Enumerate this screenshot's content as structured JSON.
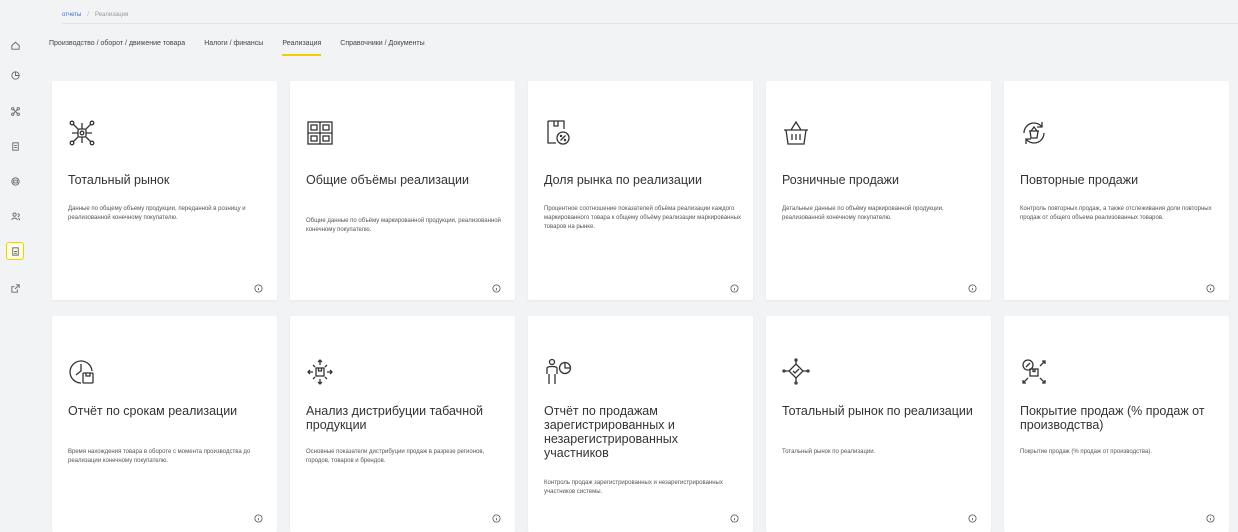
{
  "breadcrumb": {
    "root": "отчеты",
    "separator": "/",
    "current": "Реализация"
  },
  "tabs": [
    {
      "label": "Производство / оборот / движение товара",
      "active": false
    },
    {
      "label": "Налоги / финансы",
      "active": false
    },
    {
      "label": "Реализация",
      "active": true
    },
    {
      "label": "Справочники / Документы",
      "active": false
    }
  ],
  "sidebar": {
    "items": [
      {
        "icon": "home-icon"
      },
      {
        "icon": "pie-chart-icon"
      },
      {
        "icon": "network-icon"
      },
      {
        "icon": "document-icon"
      },
      {
        "icon": "box-icon"
      },
      {
        "icon": "users-icon"
      },
      {
        "icon": "report-icon",
        "active": true
      },
      {
        "icon": "external-link-icon"
      }
    ]
  },
  "cards": [
    {
      "icon": "network-hub-icon",
      "title": "Тотальный рынок",
      "description": "Данные по общему объему продукции, переданной в розницу и реализованной конечному покупателю."
    },
    {
      "icon": "boxes-icon",
      "title": "Общие объёмы реализации",
      "description": "Общие данные по объёму маркированной продукции, реализованной конечному покупателю."
    },
    {
      "icon": "box-percent-icon",
      "title": "Доля рынка по реализации",
      "description": "Процентное соотношение показателей объёма реализации каждого маркированного товара к общему объёму реализации маркированных товаров на рынке."
    },
    {
      "icon": "basket-icon",
      "title": "Розничные продажи",
      "description": "Детальные данные по объёму маркированной продукции, реализованной конечному покупателю."
    },
    {
      "icon": "basket-repeat-icon",
      "title": "Повторные продажи",
      "description": "Контроль повторных продаж, а также отслеживания доли повторных продаж от общего объема реализованных товаров."
    },
    {
      "icon": "clock-box-icon",
      "title": "Отчёт по срокам реализации",
      "description": "Время нахождения товара в обороте с момента производства до реализации конечному покупателю."
    },
    {
      "icon": "distribution-icon",
      "title": "Анализ дистрибуции табачной продукции",
      "description": "Основные показатели дистрибуции продаж в разрезе регионов, городов, товаров и брендов."
    },
    {
      "icon": "person-chart-icon",
      "title": "Отчёт по продажам зарегистрированных и незарегистрированных участников",
      "description": "Контроль продаж зарегистрированных и незарегистрированных участников системы."
    },
    {
      "icon": "market-check-icon",
      "title": "Тотальный рынок по реализации",
      "description": "Тотальный рынок по реализации."
    },
    {
      "icon": "coverage-icon",
      "title": "Покрытие продаж (% продаж от производства)",
      "description": "Покрытие продаж (% продаж от производства)."
    }
  ]
}
